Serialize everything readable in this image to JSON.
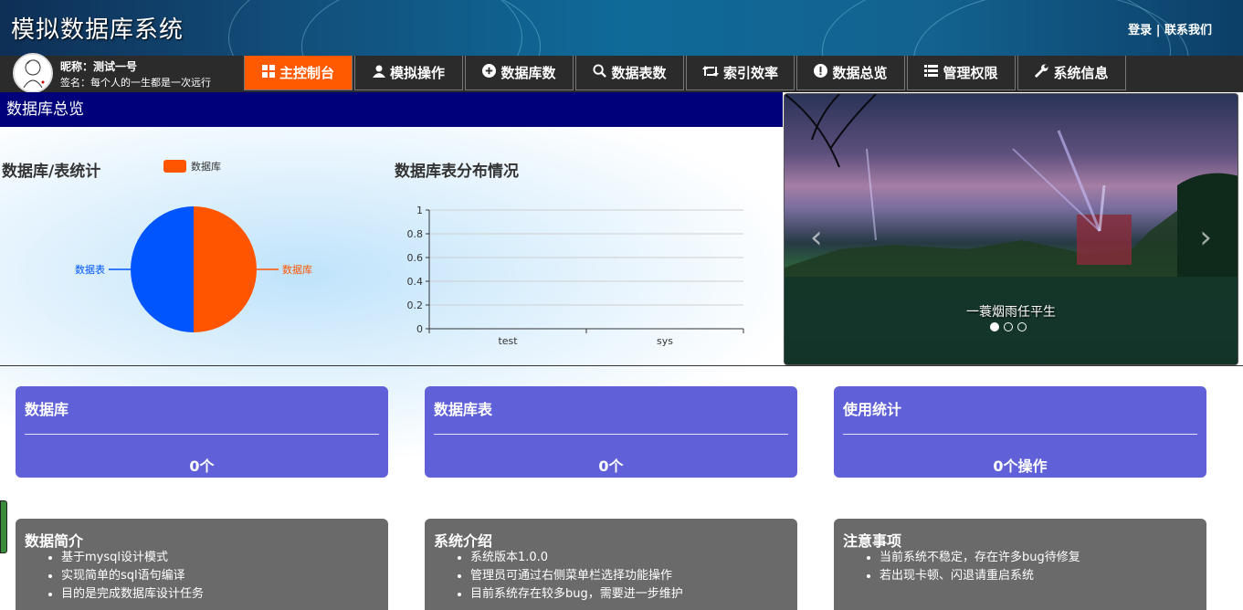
{
  "header": {
    "title": "模拟数据库系统",
    "login": "登录",
    "separator": " | ",
    "contact": "联系我们"
  },
  "user": {
    "name": "昵称：测试一号",
    "sign": "签名：每个人的一生都是一次远行"
  },
  "nav": {
    "tabs": [
      {
        "label": "主控制台",
        "icon": "grid-icon"
      },
      {
        "label": "模拟操作",
        "icon": "user-icon"
      },
      {
        "label": "数据库数",
        "icon": "plus-circle-icon"
      },
      {
        "label": "数据表数",
        "icon": "search-icon"
      },
      {
        "label": "索引效率",
        "icon": "retweet-icon"
      },
      {
        "label": "数据总览",
        "icon": "exclamation-circle-icon"
      },
      {
        "label": "管理权限",
        "icon": "list-icon"
      },
      {
        "label": "系统信息",
        "icon": "wrench-icon"
      }
    ],
    "active_index": 0,
    "active_color": "#ff5a00"
  },
  "overview": {
    "heading": "数据库总览",
    "heading_color": "#00007a"
  },
  "chart_data": [
    {
      "type": "pie",
      "title": "数据库/表统计",
      "legend": [
        "数据库"
      ],
      "slices": [
        {
          "label": "数据库",
          "value": 1,
          "color": "#ff5500"
        },
        {
          "label": "数据表",
          "value": 1,
          "color": "#0055ff"
        }
      ]
    },
    {
      "type": "bar",
      "title": "数据库表分布情况",
      "categories": [
        "test",
        "sys"
      ],
      "values": [
        0,
        0
      ],
      "ylim": [
        0,
        1
      ],
      "yticks": [
        "0",
        "0.2",
        "0.4",
        "0.6",
        "0.8",
        "1"
      ],
      "grid": true
    }
  ],
  "carousel": {
    "caption": "一蓑烟雨任平生",
    "slide_count": 3,
    "active_slide": 0,
    "prev_icon": "chevron-left-icon",
    "next_icon": "chevron-right-icon"
  },
  "stats": [
    {
      "title": "数据库",
      "value": "0个"
    },
    {
      "title": "数据库表",
      "value": "0个"
    },
    {
      "title": "使用统计",
      "value": "0个操作"
    }
  ],
  "stat_color": "#6060d8",
  "info": [
    {
      "title": "数据简介",
      "items": [
        "基于mysql设计模式",
        "实现简单的sql语句编译",
        "目的是完成数据库设计任务"
      ]
    },
    {
      "title": "系统介绍",
      "items": [
        "系统版本1.0.0",
        "管理员可通过右侧菜单栏选择功能操作",
        "目前系统存在较多bug，需要进一步维护"
      ]
    },
    {
      "title": "注意事项",
      "items": [
        "当前系统不稳定，存在许多bug待修复",
        "若出现卡顿、闪退请重启系统"
      ]
    }
  ]
}
